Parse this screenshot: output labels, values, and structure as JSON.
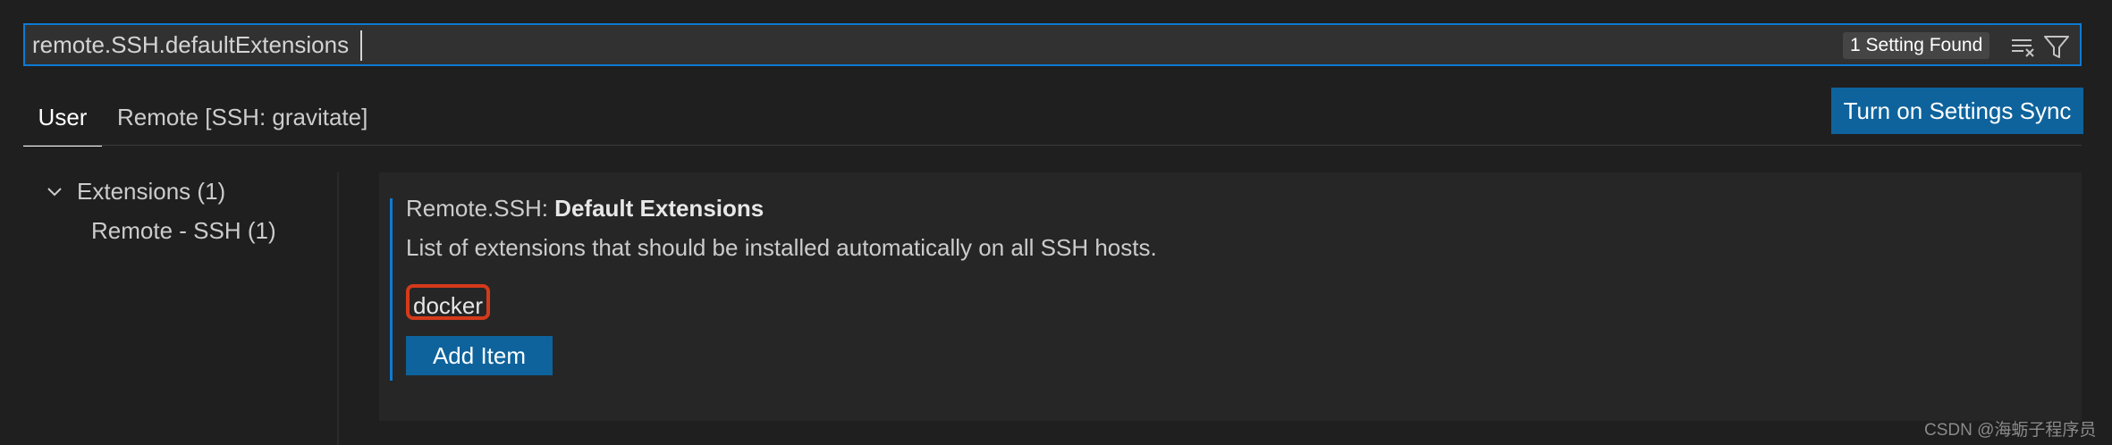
{
  "search": {
    "value": "remote.SSH.defaultExtensions",
    "results_count": "1 Setting Found",
    "clear_filter_icon": "clear-filter-icon",
    "filter_icon": "filter-icon"
  },
  "tabs": [
    {
      "label": "User",
      "active": true
    },
    {
      "label": "Remote [SSH: gravitate]",
      "active": false
    }
  ],
  "sync_button_label": "Turn on Settings Sync",
  "toc": {
    "group_label": "Extensions (1)",
    "child_label": "Remote - SSH (1)"
  },
  "setting": {
    "category": "Remote.SSH: ",
    "name": "Default Extensions",
    "description": "List of extensions that should be installed automatically on all SSH hosts.",
    "items": [
      "docker"
    ],
    "add_item_label": "Add Item"
  },
  "watermark": "CSDN @海蛎子程序员",
  "colors": {
    "accent": "#0e7ad4",
    "button": "#0e639c",
    "highlight": "#d43a1a"
  }
}
